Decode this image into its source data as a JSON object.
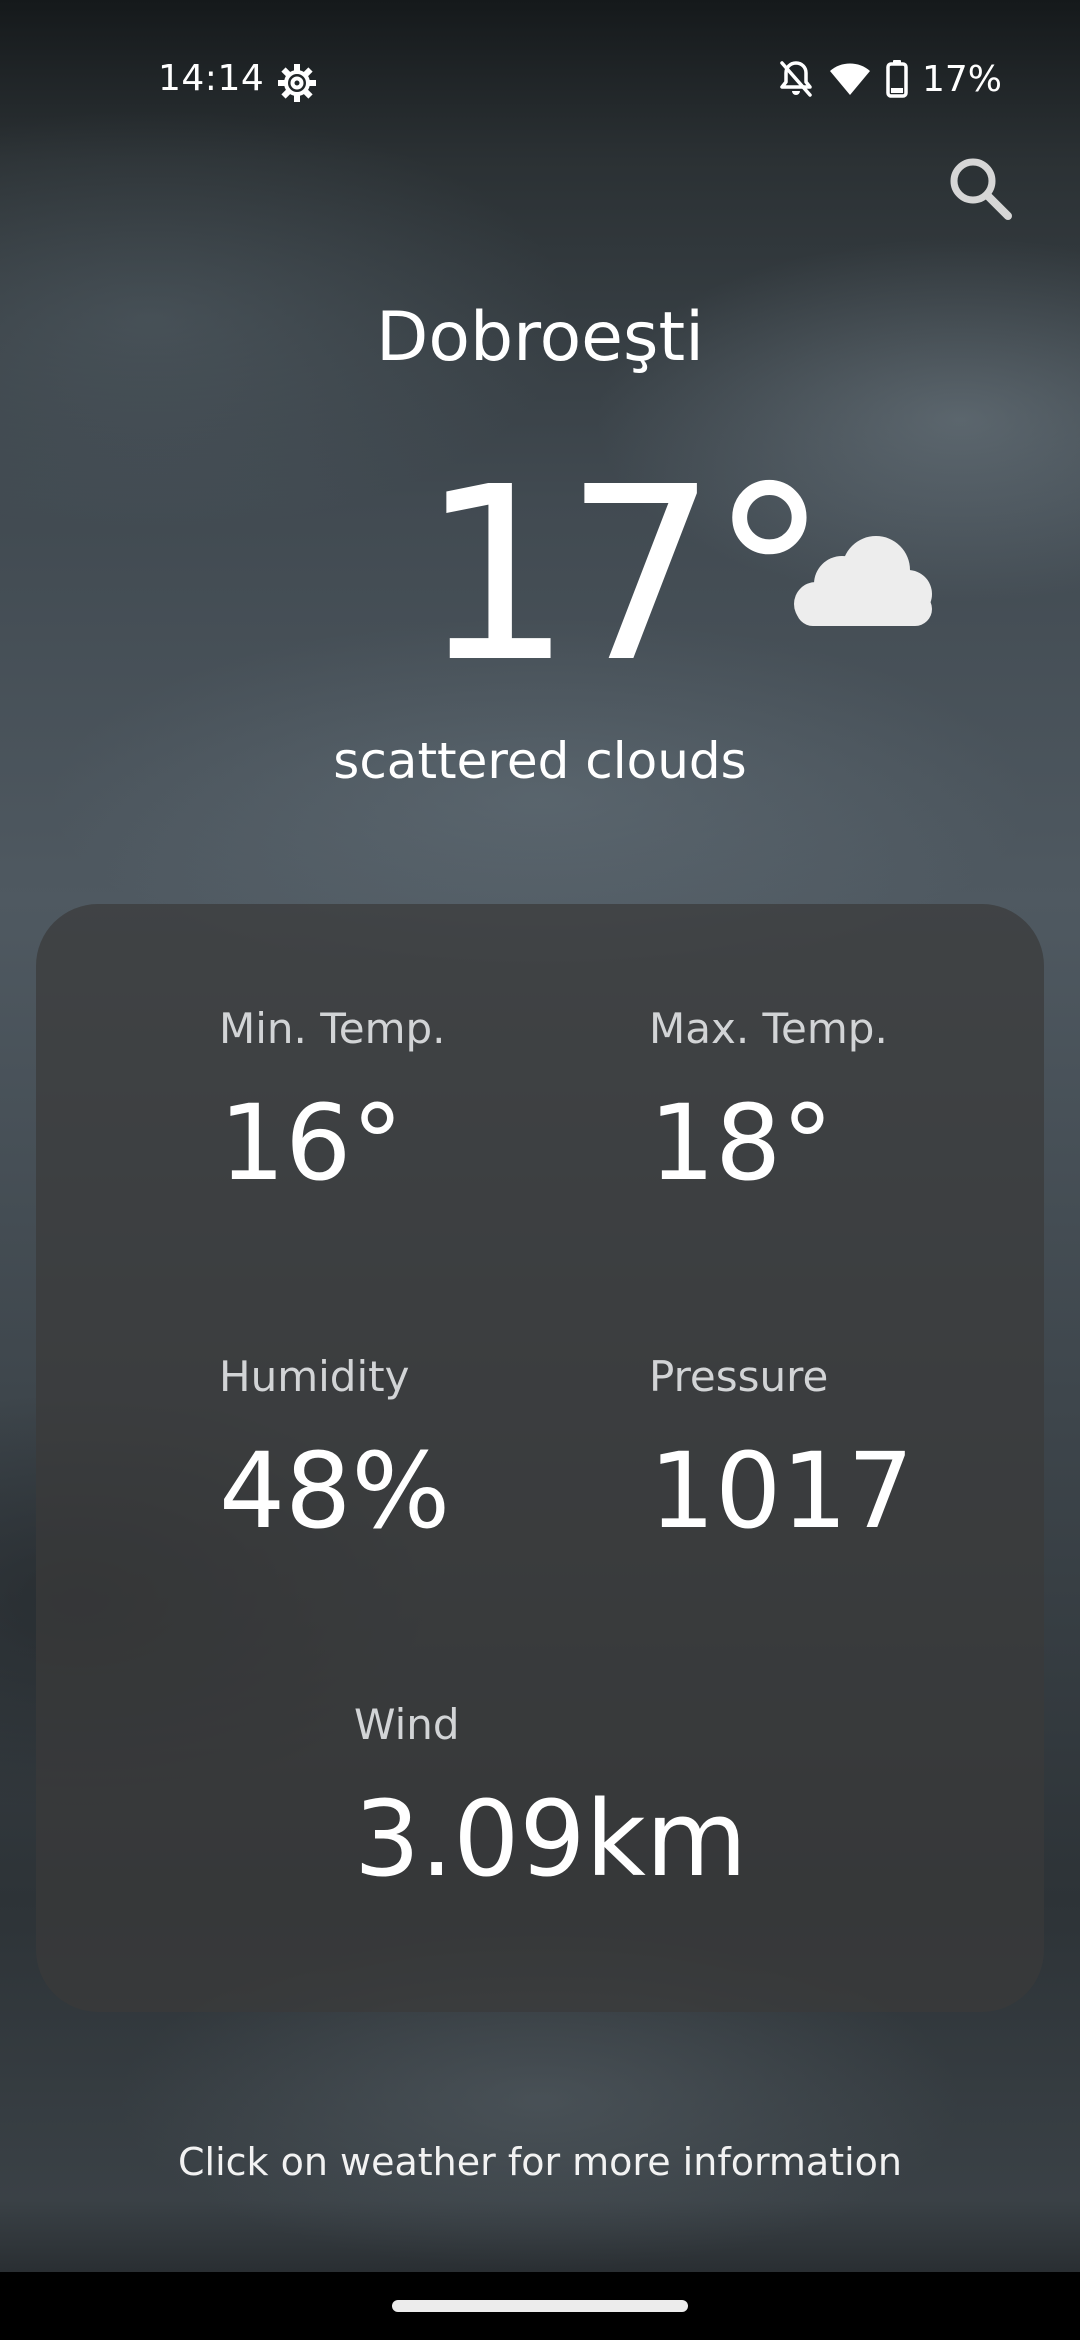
{
  "status_bar": {
    "time": "14:14",
    "battery_percent": "17%",
    "icons": [
      "settings-gear-icon",
      "notifications-off-icon",
      "wifi-icon",
      "battery-icon"
    ]
  },
  "search": {
    "icon": "search-icon"
  },
  "weather": {
    "city": "Dobroeşti",
    "temperature": "17°",
    "condition_icon": "cloud-icon",
    "description": "scattered clouds"
  },
  "details": {
    "min_temp": {
      "label": "Min. Temp.",
      "value": "16°"
    },
    "max_temp": {
      "label": "Max. Temp.",
      "value": "18°"
    },
    "humidity": {
      "label": "Humidity",
      "value": "48%"
    },
    "pressure": {
      "label": "Pressure",
      "value": "1017"
    },
    "wind": {
      "label": "Wind",
      "value": "3.09km"
    }
  },
  "hint": "Click on weather for more information",
  "colors": {
    "card_background": "#3a3a3a",
    "text_primary": "#ffffff",
    "text_secondary": "#d2d4d6"
  }
}
